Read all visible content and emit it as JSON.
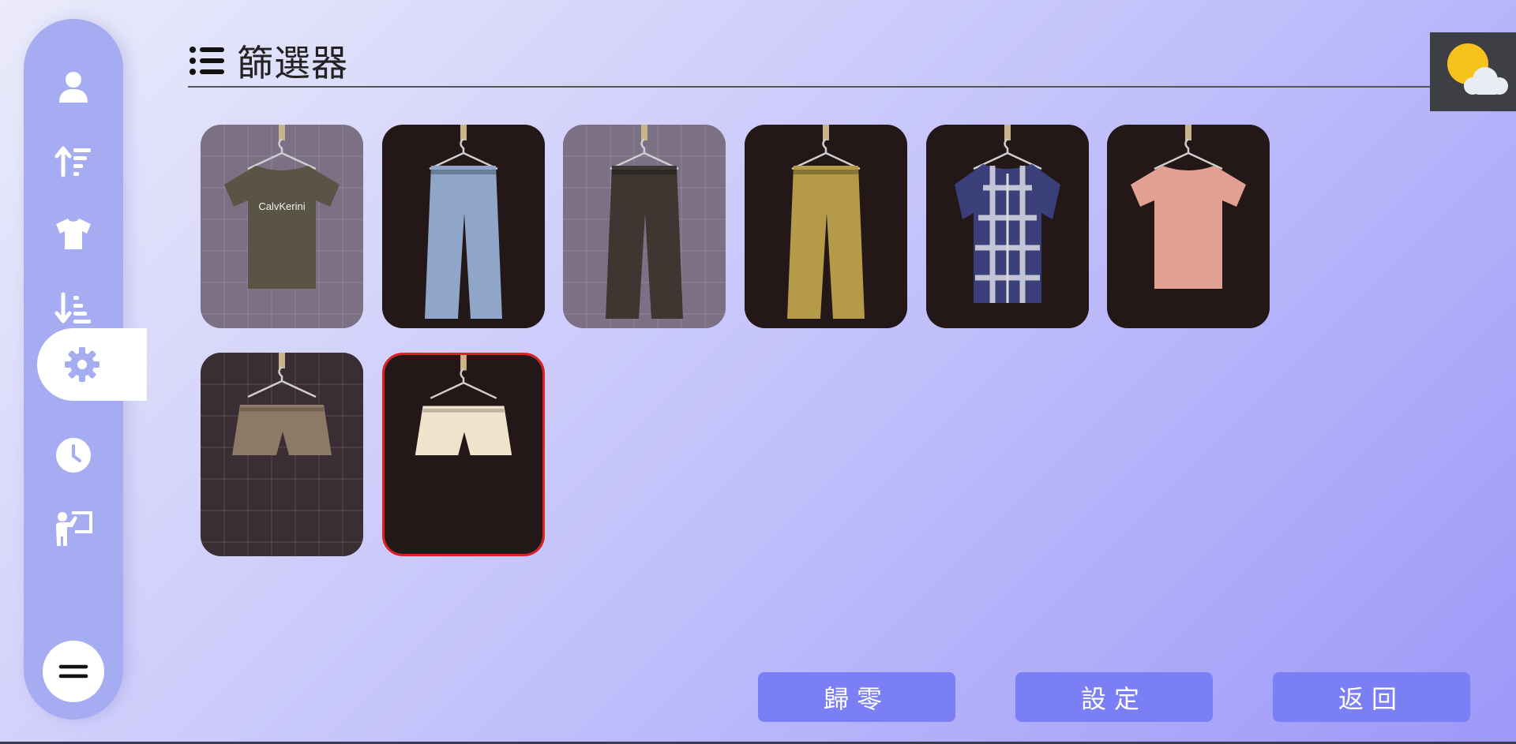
{
  "header": {
    "title": "篩選器",
    "icon": "list-icon"
  },
  "sidebar": {
    "items": [
      {
        "name": "user-icon",
        "active": false
      },
      {
        "name": "sort-ascending-icon",
        "active": false
      },
      {
        "name": "shirt-icon",
        "active": false
      },
      {
        "name": "sort-descending-icon",
        "active": false
      },
      {
        "name": "gear-icon",
        "active": true
      },
      {
        "name": "clock-icon",
        "active": false
      },
      {
        "name": "presenter-icon",
        "active": false
      }
    ],
    "menu_icon": "menu-icon"
  },
  "weather": {
    "icon": "partly-cloudy-icon"
  },
  "clothing_items": [
    {
      "type": "t-shirt",
      "color": "#5a5446",
      "background": "light-plaid",
      "print": "CalvKerini"
    },
    {
      "type": "jeans",
      "color": "#8fa6c8",
      "background": "dark",
      "print": ""
    },
    {
      "type": "pants",
      "color": "#3e3630",
      "background": "light-plaid",
      "print": ""
    },
    {
      "type": "pants",
      "color": "#b59a49",
      "background": "dark",
      "print": ""
    },
    {
      "type": "plaid-shirt",
      "color": "#3a3f7a",
      "background": "dark",
      "print": ""
    },
    {
      "type": "t-shirt",
      "color": "#e2a093",
      "background": "dark",
      "print": ""
    },
    {
      "type": "shorts",
      "color": "#8d7a66",
      "background": "dark-plaid",
      "print": ""
    },
    {
      "type": "shorts",
      "color": "#efe3cc",
      "background": "dark",
      "print": "",
      "selected": true
    }
  ],
  "buttons": {
    "reset": "歸零",
    "set": "設定",
    "back": "返回"
  },
  "colors": {
    "sidebar": "#a5acf2",
    "button": "#7b7ff5",
    "selected_border": "#e0201f"
  }
}
